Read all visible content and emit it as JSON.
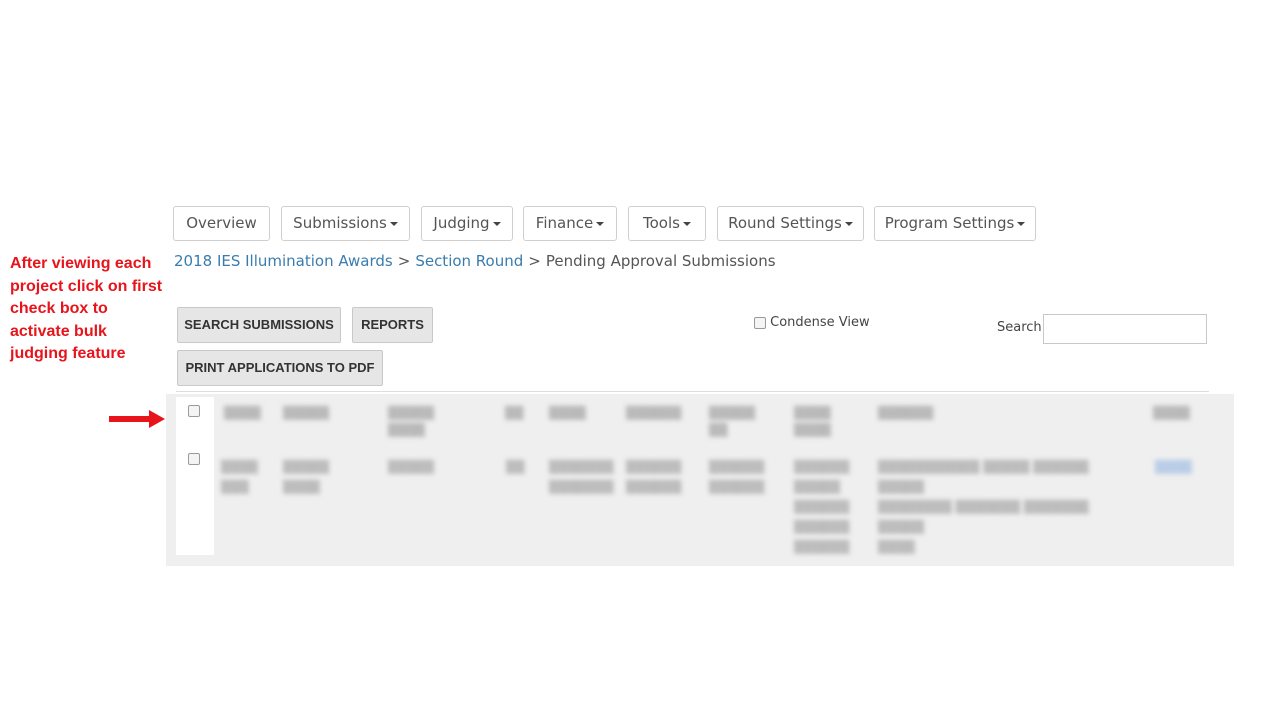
{
  "annotation": {
    "lines": [
      "After viewing each",
      "project click on first",
      "check box to",
      "activate bulk",
      "judging feature"
    ],
    "color": "#e8141b"
  },
  "nav": {
    "overview": "Overview",
    "submissions": "Submissions",
    "judging": "Judging",
    "finance": "Finance",
    "tools": "Tools",
    "round_settings": "Round Settings",
    "program_settings": "Program Settings"
  },
  "breadcrumb": {
    "program": "2018 IES Illumination Awards",
    "round": "Section Round",
    "current": "Pending Approval Submissions",
    "separator": ">",
    "link_color": "#3a7cae"
  },
  "toolbar": {
    "search_submissions": "SEARCH SUBMISSIONS",
    "reports": "REPORTS",
    "print_pdf": "PRINT APPLICATIONS TO PDF",
    "condense_view": "Condense View",
    "search_label": "Search:"
  }
}
